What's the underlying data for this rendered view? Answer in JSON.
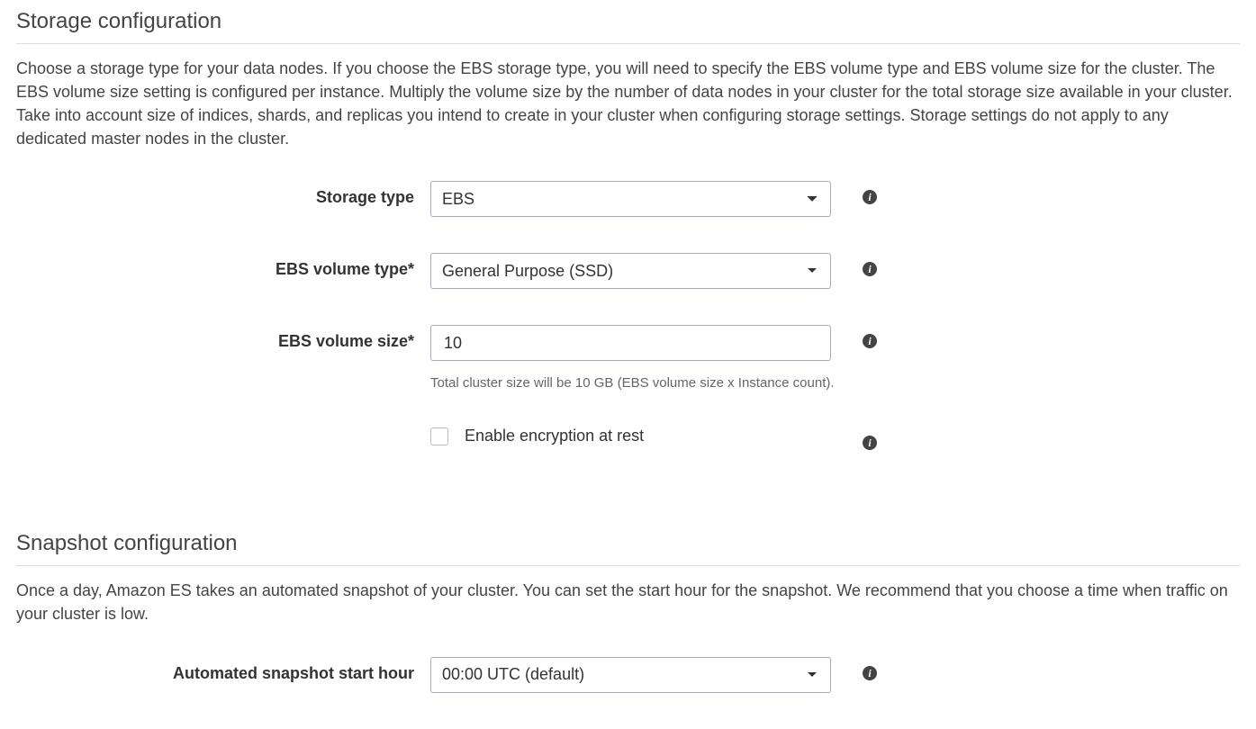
{
  "storage": {
    "title": "Storage configuration",
    "description": "Choose a storage type for your data nodes. If you choose the EBS storage type, you will need to specify the EBS volume type and EBS volume size for the cluster. The EBS volume size setting is configured per instance. Multiply the volume size by the number of data nodes in your cluster for the total storage size available in your cluster. Take into account size of indices, shards, and replicas you intend to create in your cluster when configuring storage settings. Storage settings do not apply to any dedicated master nodes in the cluster.",
    "fields": {
      "storage_type": {
        "label": "Storage type",
        "value": "EBS"
      },
      "ebs_volume_type": {
        "label": "EBS volume type*",
        "value": "General Purpose (SSD)"
      },
      "ebs_volume_size": {
        "label": "EBS volume size*",
        "value": "10",
        "hint": "Total cluster size will be 10 GB (EBS volume size x Instance count)."
      },
      "encryption": {
        "label": "Enable encryption at rest",
        "checked": false
      }
    }
  },
  "snapshot": {
    "title": "Snapshot configuration",
    "description": "Once a day, Amazon ES takes an automated snapshot of your cluster. You can set the start hour for the snapshot. We recommend that you choose a time when traffic on your cluster is low.",
    "fields": {
      "start_hour": {
        "label": "Automated snapshot start hour",
        "value": "00:00 UTC (default)"
      }
    }
  }
}
